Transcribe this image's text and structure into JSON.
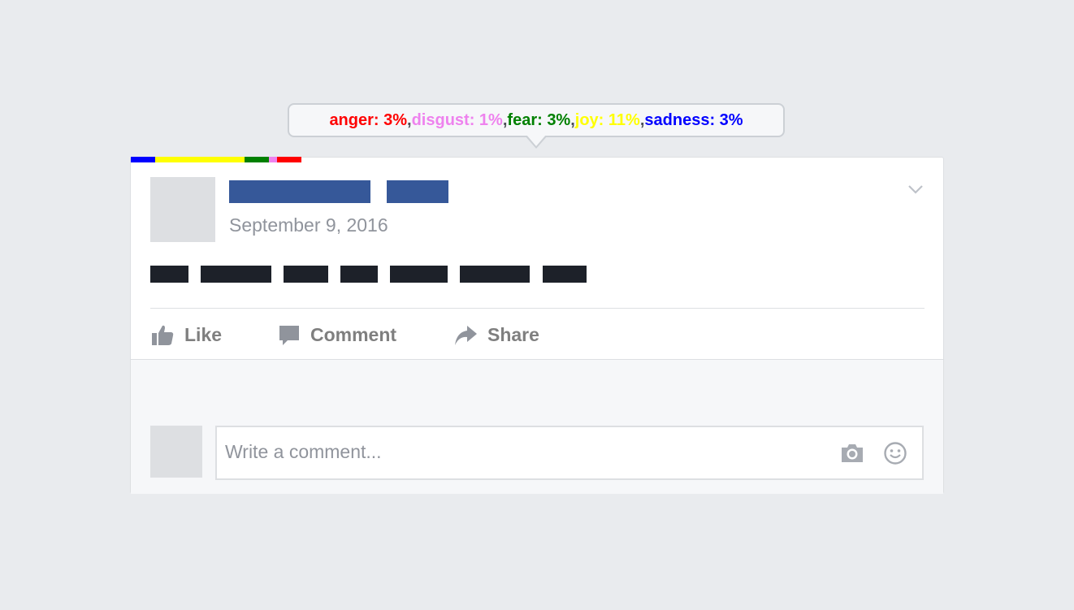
{
  "emotion_tooltip": {
    "items": [
      {
        "label": "anger: 3%",
        "color": "#ff0000"
      },
      {
        "label": "disgust: 1%",
        "color": "#ee82ee"
      },
      {
        "label": "fear: 3%",
        "color": "#008000"
      },
      {
        "label": "joy: 11%",
        "color": "#ffff00"
      },
      {
        "label": "sadness: 3%",
        "color": "#0000ff"
      }
    ],
    "separator": ", "
  },
  "emotion_bar": {
    "segments": [
      {
        "emotion": "sadness",
        "value": 3,
        "color": "#0000ff"
      },
      {
        "emotion": "joy",
        "value": 11,
        "color": "#ffff00"
      },
      {
        "emotion": "fear",
        "value": 3,
        "color": "#008000"
      },
      {
        "emotion": "disgust",
        "value": 1,
        "color": "#ee82ee"
      },
      {
        "emotion": "anger",
        "value": 3,
        "color": "#ff0000"
      }
    ]
  },
  "post": {
    "date": "September 9, 2016",
    "author_redaction_color": "#365899",
    "text_redaction_color": "#1d2129",
    "menu_icon": "chevron-down-icon"
  },
  "actions": {
    "like": {
      "label": "Like",
      "icon": "thumbs-up-icon"
    },
    "comment": {
      "label": "Comment",
      "icon": "speech-bubble-icon"
    },
    "share": {
      "label": "Share",
      "icon": "share-arrow-icon"
    }
  },
  "composer": {
    "placeholder": "Write a comment...",
    "camera_icon": "camera-icon",
    "emoji_icon": "smiley-icon"
  }
}
